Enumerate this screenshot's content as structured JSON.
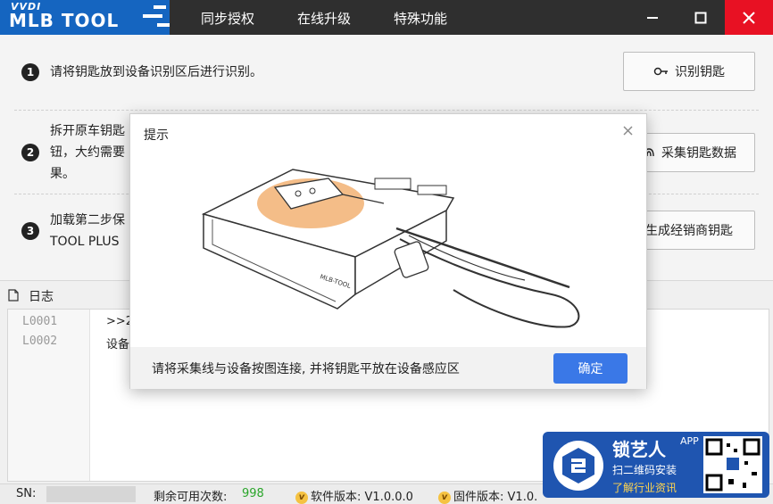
{
  "app": {
    "brand_top": "VVDI",
    "brand_name": "MLB TOOL"
  },
  "menu": [
    {
      "label": "同步授权"
    },
    {
      "label": "在线升级"
    },
    {
      "label": "特殊功能"
    }
  ],
  "steps": [
    {
      "num": "1",
      "lines": [
        "请将钥匙放到设备识别区后进行识别。"
      ],
      "button": "识别钥匙"
    },
    {
      "num": "2",
      "lines": [
        "拆开原车钥匙",
        "钮，大约需要",
        "果。"
      ],
      "button": "采集钥匙数据"
    },
    {
      "num": "3",
      "lines": [
        "加载第二步保",
        "TOOL PLUS"
      ],
      "button": "生成经销商钥匙"
    }
  ],
  "log": {
    "title": "日志",
    "rows": [
      {
        "line": "L0001",
        "text": ">>2"
      },
      {
        "line": "L0002",
        "text": "设备"
      }
    ]
  },
  "status": {
    "sn_label": "SN:",
    "remaining_label": "剩余可用次数:",
    "remaining_value": "998",
    "software_label": "软件版本:",
    "software_value": "V1.0.0.0",
    "firmware_label": "固件版本:",
    "firmware_value": "V1.0."
  },
  "dialog": {
    "title": "提示",
    "message": "请将采集线与设备按图连接, 并将钥匙平放在设备感应区",
    "ok_label": "确定",
    "device_label": "MLB-TOOL"
  },
  "ad": {
    "brand": "锁艺人",
    "app_tag": "APP",
    "line1": "扫二维码安装",
    "line2": "了解行业资讯"
  },
  "colors": {
    "accent": "#3a78e7",
    "logo_bg": "#1565c0",
    "titlebar": "#2f2f2f",
    "close_red": "#e81123",
    "count_green": "#2aa52a",
    "orange_zone": "#f2b173"
  }
}
